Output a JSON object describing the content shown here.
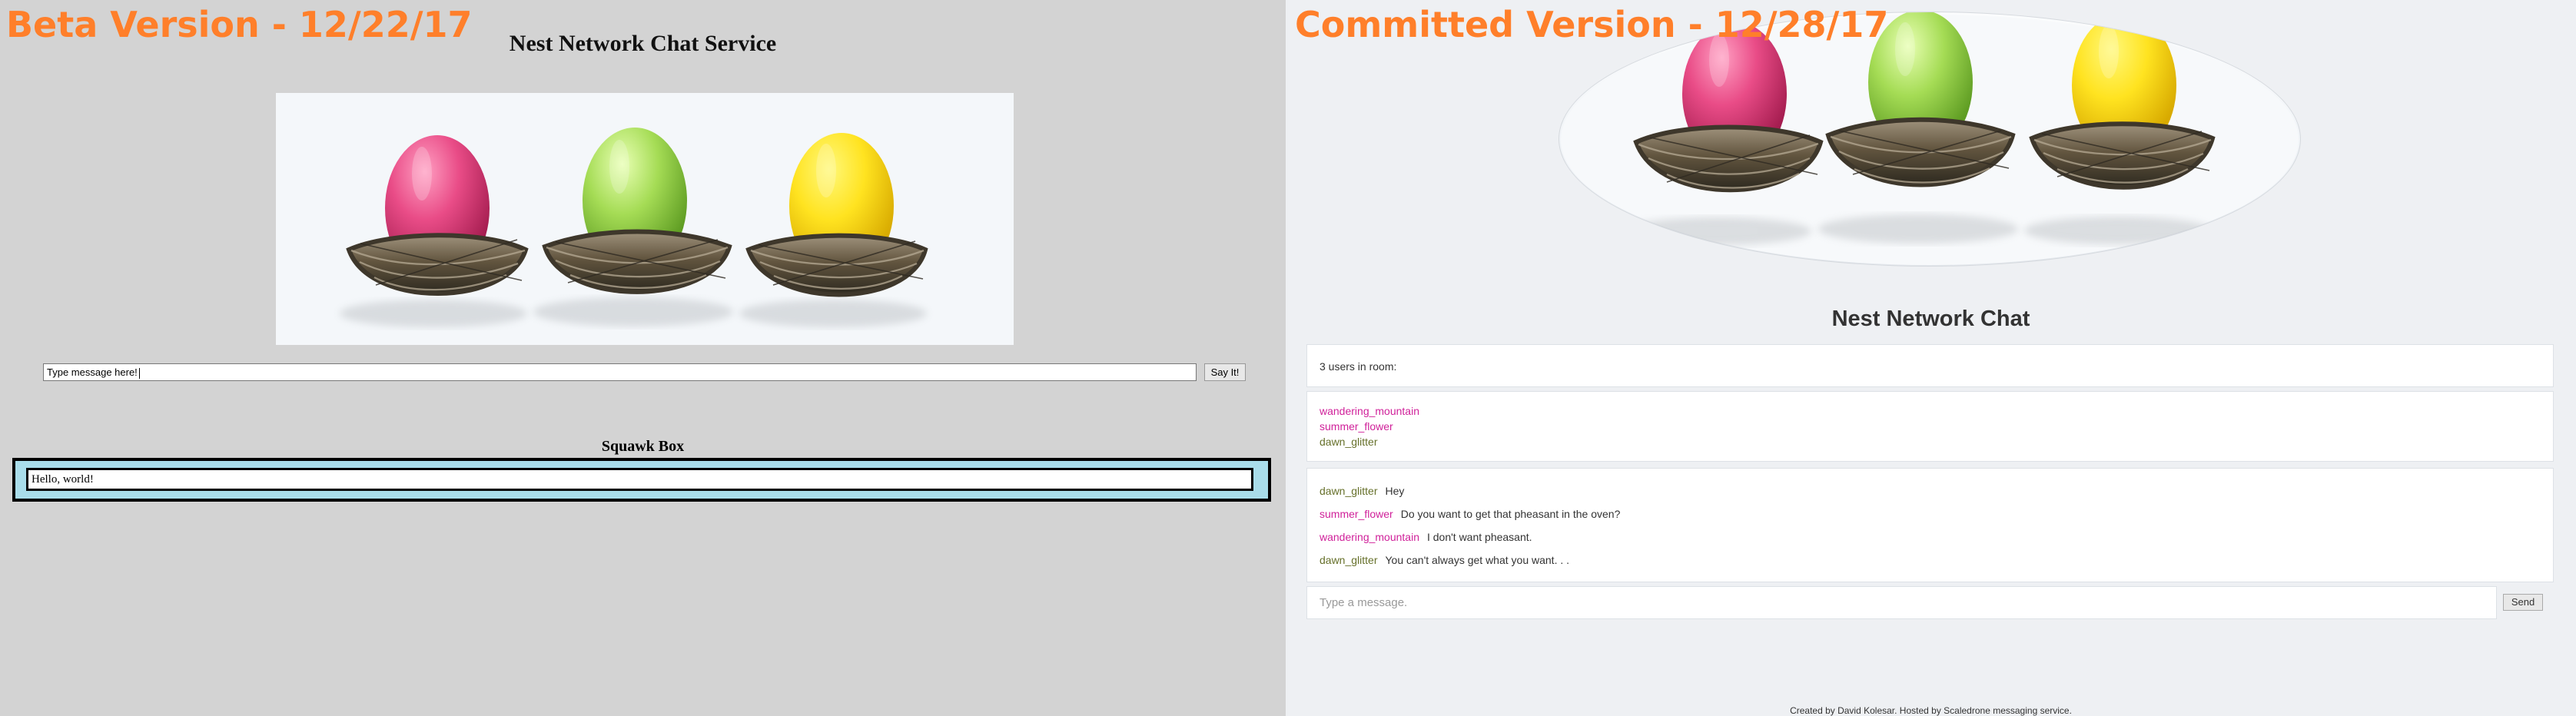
{
  "colors": {
    "version_label": "#ff7f2a",
    "beta_background": "#d3d3d3",
    "committed_background": "#eef0f3",
    "squawk_box_background": "#a9ddea",
    "user_magenta": "#d0219a",
    "user_olive": "#66702a"
  },
  "beta": {
    "version_label": "Beta Version - 12/22/17",
    "title": "Nest Network Chat Service",
    "hero_icon": "easter-eggs-in-nests",
    "message_input": "Type message here!",
    "say_button": "Say It!",
    "squawk_heading": "Squawk Box",
    "squawk_message": "Hello, world!"
  },
  "committed": {
    "version_label": "Committed Version - 12/28/17",
    "hero_icon": "easter-eggs-in-nests",
    "title": "Nest Network Chat",
    "users_count": "3 users in room:",
    "members": [
      {
        "name": "wandering_mountain",
        "color": "#d0219a"
      },
      {
        "name": "summer_flower",
        "color": "#d0219a"
      },
      {
        "name": "dawn_glitter",
        "color": "#66702a"
      }
    ],
    "messages": [
      {
        "author": "dawn_glitter",
        "color": "#66702a",
        "text": "Hey"
      },
      {
        "author": "summer_flower",
        "color": "#d0219a",
        "text": "Do you want to get that pheasant in the oven?"
      },
      {
        "author": "wandering_mountain",
        "color": "#d0219a",
        "text": "I don't want pheasant."
      },
      {
        "author": "dawn_glitter",
        "color": "#66702a",
        "text": "You can't always get what you want. . ."
      }
    ],
    "input_placeholder": "Type a message.",
    "send_button": "Send",
    "footer": "Created by David Kolesar. Hosted by Scaledrone messaging service."
  }
}
